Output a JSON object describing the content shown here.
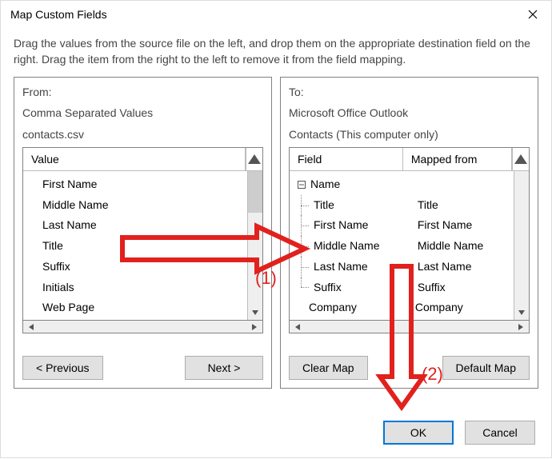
{
  "window": {
    "title": "Map Custom Fields",
    "close_icon_name": "close-icon"
  },
  "instruction": "Drag the values from the source file on the left, and drop them on the appropriate destination field on the right.  Drag the item from the right to the left to remove it from the field mapping.",
  "from": {
    "label": "From:",
    "format": "Comma Separated Values",
    "file": "contacts.csv",
    "header_value": "Value",
    "items": [
      "First Name",
      "Middle Name",
      "Last Name",
      "Title",
      "Suffix",
      "Initials",
      "Web Page"
    ]
  },
  "to": {
    "label": "To:",
    "target": "Microsoft Office Outlook",
    "folder": "Contacts (This computer only)",
    "header_field": "Field",
    "header_mapped": "Mapped from",
    "root": "Name",
    "rows": [
      {
        "field": "Title",
        "mapped": "Title"
      },
      {
        "field": "First Name",
        "mapped": "First Name"
      },
      {
        "field": "Middle Name",
        "mapped": "Middle Name"
      },
      {
        "field": "Last Name",
        "mapped": "Last Name"
      },
      {
        "field": "Suffix",
        "mapped": "Suffix"
      },
      {
        "field": "Company",
        "mapped": "Company"
      }
    ]
  },
  "buttons": {
    "previous": "< Previous",
    "next": "Next >",
    "clear_map": "Clear Map",
    "default_map": "Default Map",
    "ok": "OK",
    "cancel": "Cancel"
  },
  "annotations": {
    "step1": "(1)",
    "step2": "(2)"
  },
  "colors": {
    "accent_red": "#e1211d",
    "ok_border_blue": "#0078d7"
  }
}
